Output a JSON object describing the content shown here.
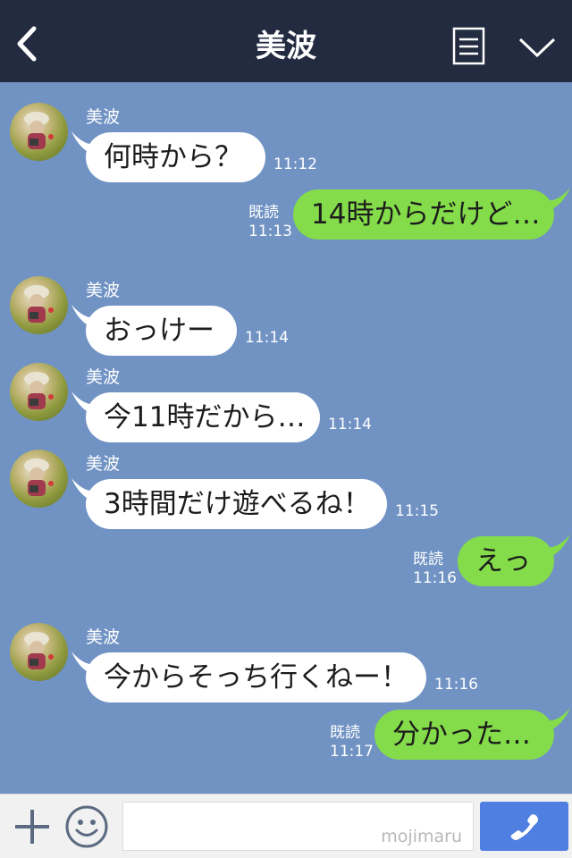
{
  "header": {
    "title": "美波"
  },
  "messages": [
    {
      "id": "m1",
      "sender": "美波",
      "text": "何時から？",
      "time": "11:12"
    },
    {
      "id": "m2",
      "text": "14時からだけど…",
      "read": "既読",
      "time": "11:13"
    },
    {
      "id": "m3",
      "sender": "美波",
      "text": "おっけー",
      "time": "11:14"
    },
    {
      "id": "m4",
      "sender": "美波",
      "text": "今11時だから…",
      "time": "11:14"
    },
    {
      "id": "m5",
      "sender": "美波",
      "text": "3時間だけ遊べるね！",
      "time": "11:15"
    },
    {
      "id": "m6",
      "text": "えっ",
      "read": "既読",
      "time": "11:16"
    },
    {
      "id": "m7",
      "sender": "美波",
      "text": "今からそっち行くねー！",
      "time": "11:16"
    },
    {
      "id": "m8",
      "text": "分かった…",
      "read": "既読",
      "time": "11:17"
    }
  ],
  "footer": {
    "watermark": "mojimaru",
    "input_value": ""
  },
  "colors": {
    "header_bg": "#232b40",
    "chat_bg": "#7093c4",
    "outgoing_bubble": "#84dc4a",
    "incoming_bubble": "#ffffff",
    "call_button": "#4f7fe0"
  }
}
